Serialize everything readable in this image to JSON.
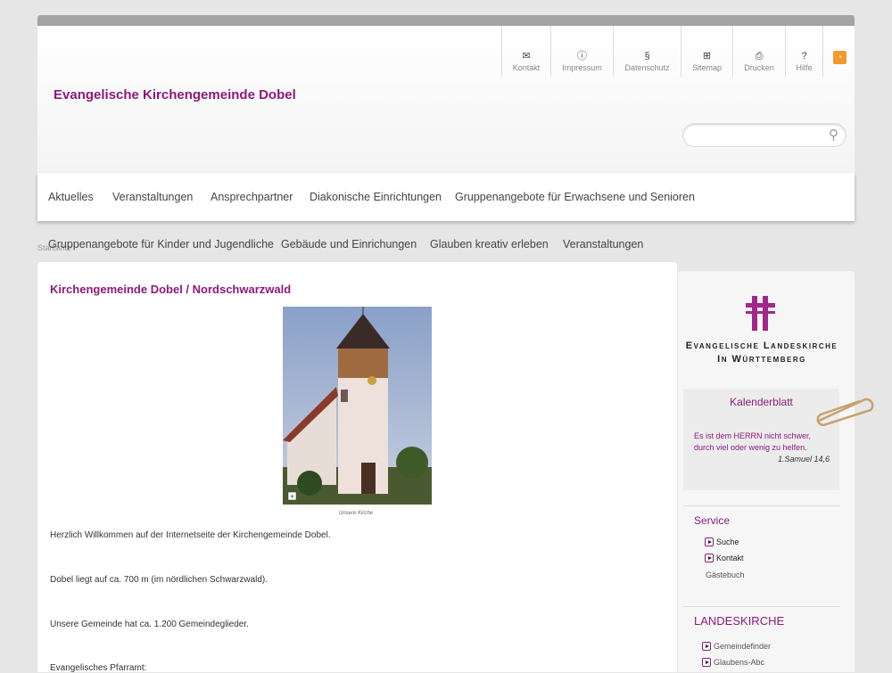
{
  "header": {
    "site_title": "Evangelische Kirchengemeinde Dobel",
    "quicklinks": [
      {
        "label": "Kontakt",
        "icon": "envelope-icon"
      },
      {
        "label": "Impressum",
        "icon": "info-icon"
      },
      {
        "label": "Datenschutz",
        "icon": "section-icon"
      },
      {
        "label": "Sitemap",
        "icon": "sitemap-icon"
      },
      {
        "label": "Drucken",
        "icon": "printer-icon"
      },
      {
        "label": "Hilfe",
        "icon": "help-icon"
      }
    ],
    "search_placeholder": ""
  },
  "nav": [
    "Aktuelles",
    "Veranstaltungen",
    "Ansprechpartner",
    "Diakonische Einrichtungen",
    "Gruppenangebote für Erwachsene und Senioren",
    "Gruppenangebote für Kinder und Jugendliche",
    "Gebäude und Einrichungen",
    "Glauben kreativ erleben",
    "Veranstaltungen"
  ],
  "breadcrumb": "Startseite",
  "main": {
    "title": "Kirchengemeinde Dobel / Nordschwarzwald",
    "caption": "Unsere Kirche",
    "paragraphs": [
      "Herzlich Willkommen auf der Internetseite der Kirchengemeinde Dobel.",
      "Dobel liegt auf ca. 700 m (im nördlichen Schwarzwald).",
      "Unsere Gemeinde hat ca. 1.200 Gemeindeglieder.",
      "Evangelisches Pfarramt:"
    ]
  },
  "sidebar": {
    "logo_line1": "Evangelische Landeskirche",
    "logo_line2": "In Württemberg",
    "kalender": {
      "title": "Kalenderblatt",
      "line1": "Es ist dem HERRN nicht schwer,",
      "line2": "durch viel oder wenig zu helfen.",
      "ref": "1.Samuel 14,6"
    },
    "service": {
      "title": "Service",
      "items": [
        "Suche",
        "Kontakt",
        "Gästebuch"
      ]
    },
    "landeskirche": {
      "title": "LANDESKIRCHE",
      "items": [
        "Gemeindefinder",
        "Glaubens-Abc"
      ]
    }
  },
  "colors": {
    "accent": "#8b1a7e",
    "rss": "#f29a2e"
  }
}
